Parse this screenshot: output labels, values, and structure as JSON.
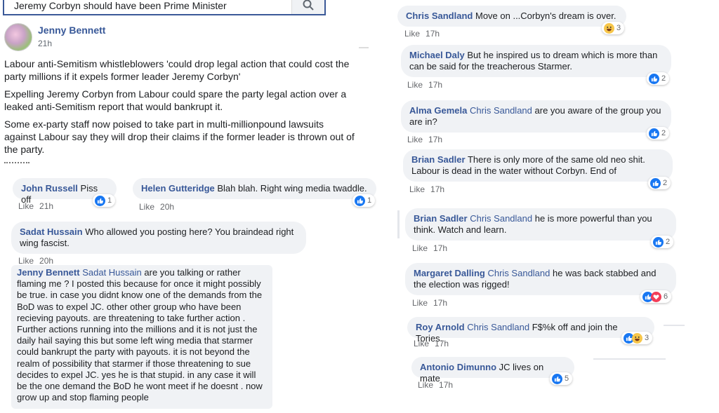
{
  "search": {
    "query": "Jeremy Corbyn should have been Prime Minister"
  },
  "post": {
    "author": "Jenny Bennett",
    "time": "21h",
    "paragraphs": [
      "Labour anti-Semitism whistleblowers 'could drop legal action that could cost the party millions if it expels former leader Jeremy Corbyn'",
      "Expelling Jeremy Corbyn from Labour could spare the party legal action over a leaked anti-Semitism report that would bankrupt it.",
      "Some ex-party staff now poised to take part in multi-millionpound lawsuits against Labour say they will drop their claims if the former leader is thrown out of the party."
    ]
  },
  "like_label": "Like",
  "left_comments": [
    {
      "name": "John Russell",
      "text": "Piss off",
      "time": "21h",
      "reactions": "1"
    },
    {
      "name": "Helen Gutteridge",
      "text": "Blah blah. Right wing media twaddle.",
      "time": "20h",
      "reactions": "1"
    },
    {
      "name": "Sadat Hussain",
      "text": "Who allowed you posting here? You braindead right wing fascist.",
      "time": "20h"
    },
    {
      "name": "Jenny Bennett",
      "tag": "Sadat Hussain",
      "text": "are you talking or rather flaming me ? I posted this because for once it might possibly be true. in case you didnt know one of the demands from the BoD was to expel JC. other other group who have been recieving payouts. are threatening to take further action . Further actions running into the millions and it is not just the daily hail saying this but some left wing media that starmer could bankrupt the party with payouts. it is not beyond the realm of possibility that starmer if those threatening to sue decides to expel JC. yes he is that stupid. in any case it will be the one demand the BoD he wont meet if he doesnt . now grow up and stop flaming people"
    }
  ],
  "right_comments": [
    {
      "name": "Chris Sandland",
      "text": "Move on ...Corbyn's dream is over.",
      "time": "17h",
      "reactions": "3"
    },
    {
      "name": "Michael Daly",
      "text": "But he inspired us to dream which is more than can be said for the treacherous Starmer.",
      "time": "17h",
      "reactions": "2"
    },
    {
      "name": "Alma Gemela",
      "tag": "Chris Sandland",
      "text": "are you aware of the group you are in?",
      "time": "17h",
      "reactions": "2"
    },
    {
      "name": "Brian Sadler",
      "text": "There is only more of the same old neo shit. Labour is dead in the water without Corbyn. End of",
      "time": "17h",
      "reactions": "2"
    },
    {
      "name": "Brian Sadler",
      "tag": "Chris Sandland",
      "text": "he is more powerful than you think. Watch and learn.",
      "time": "17h",
      "reactions": "2"
    },
    {
      "name": "Margaret Dalling",
      "tag": "Chris Sandland",
      "text": "he was back stabbed and the election was rigged!",
      "time": "17h",
      "reactions": "6"
    },
    {
      "name": "Roy Arnold",
      "tag": "Chris Sandland",
      "text": "F$%k off and join the Tories.",
      "time": "17h",
      "reactions": "3"
    },
    {
      "name": "Antonio Dimunno",
      "text": "JC lives on mate",
      "time": "17h",
      "reactions": "5"
    }
  ],
  "colors": {
    "name": "#385898",
    "like": "#1877f2",
    "bubble": "#f0f2f5"
  }
}
